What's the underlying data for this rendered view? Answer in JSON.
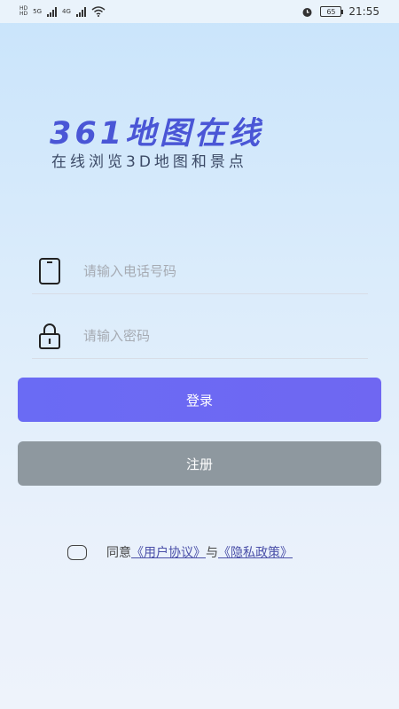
{
  "status_bar": {
    "time": "21:55",
    "network_1": "5G",
    "network_2": "4G",
    "battery": "65"
  },
  "brand": {
    "title": "361地图在线",
    "slogan": "在线浏览3D地图和景点",
    "color": "#4a56d6"
  },
  "form": {
    "phone_placeholder": "请输入电话号码",
    "password_placeholder": "请输入密码"
  },
  "buttons": {
    "login": "登录",
    "register": "注册",
    "login_color": "#6b6bf4",
    "register_color": "#8e989f"
  },
  "agreement": {
    "prefix": "同意",
    "user_agreement": "《用户协议》",
    "joiner": "与",
    "privacy_policy": "《隐私政策》",
    "checked": false
  }
}
